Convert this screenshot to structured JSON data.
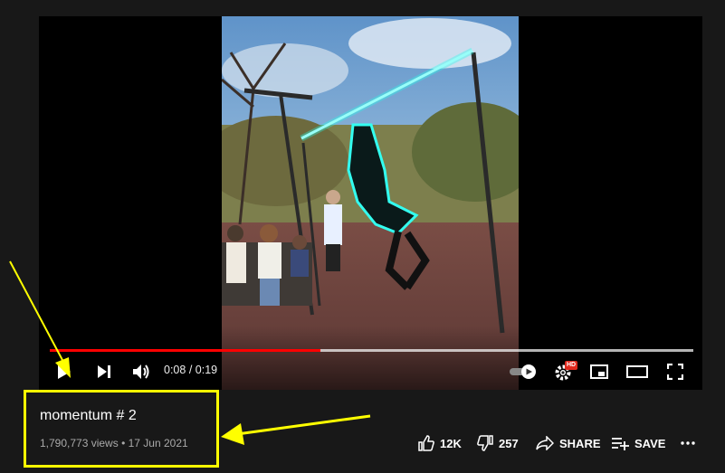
{
  "player": {
    "time_current": "0:08",
    "time_separator": " / ",
    "time_total": "0:19",
    "progress_played_fraction": 0.42,
    "progress_buffered_fraction": 1.0,
    "hd_badge": "HD",
    "icons": [
      "play-icon",
      "next-icon",
      "volume-icon",
      "autoplay-toggle-icon",
      "settings-icon",
      "miniplayer-icon",
      "theater-icon",
      "fullscreen-icon"
    ]
  },
  "video": {
    "title": "momentum # 2",
    "views": "1,790,773 views",
    "separator": " • ",
    "date": "17 Jun 2021"
  },
  "actions": {
    "like_count": "12K",
    "dislike_count": "257",
    "share_label": "SHARE",
    "save_label": "SAVE"
  },
  "colors": {
    "background": "#181818",
    "progress": "#ff0000",
    "annotation": "#ffff00",
    "meta_text": "#aaaaaa"
  }
}
